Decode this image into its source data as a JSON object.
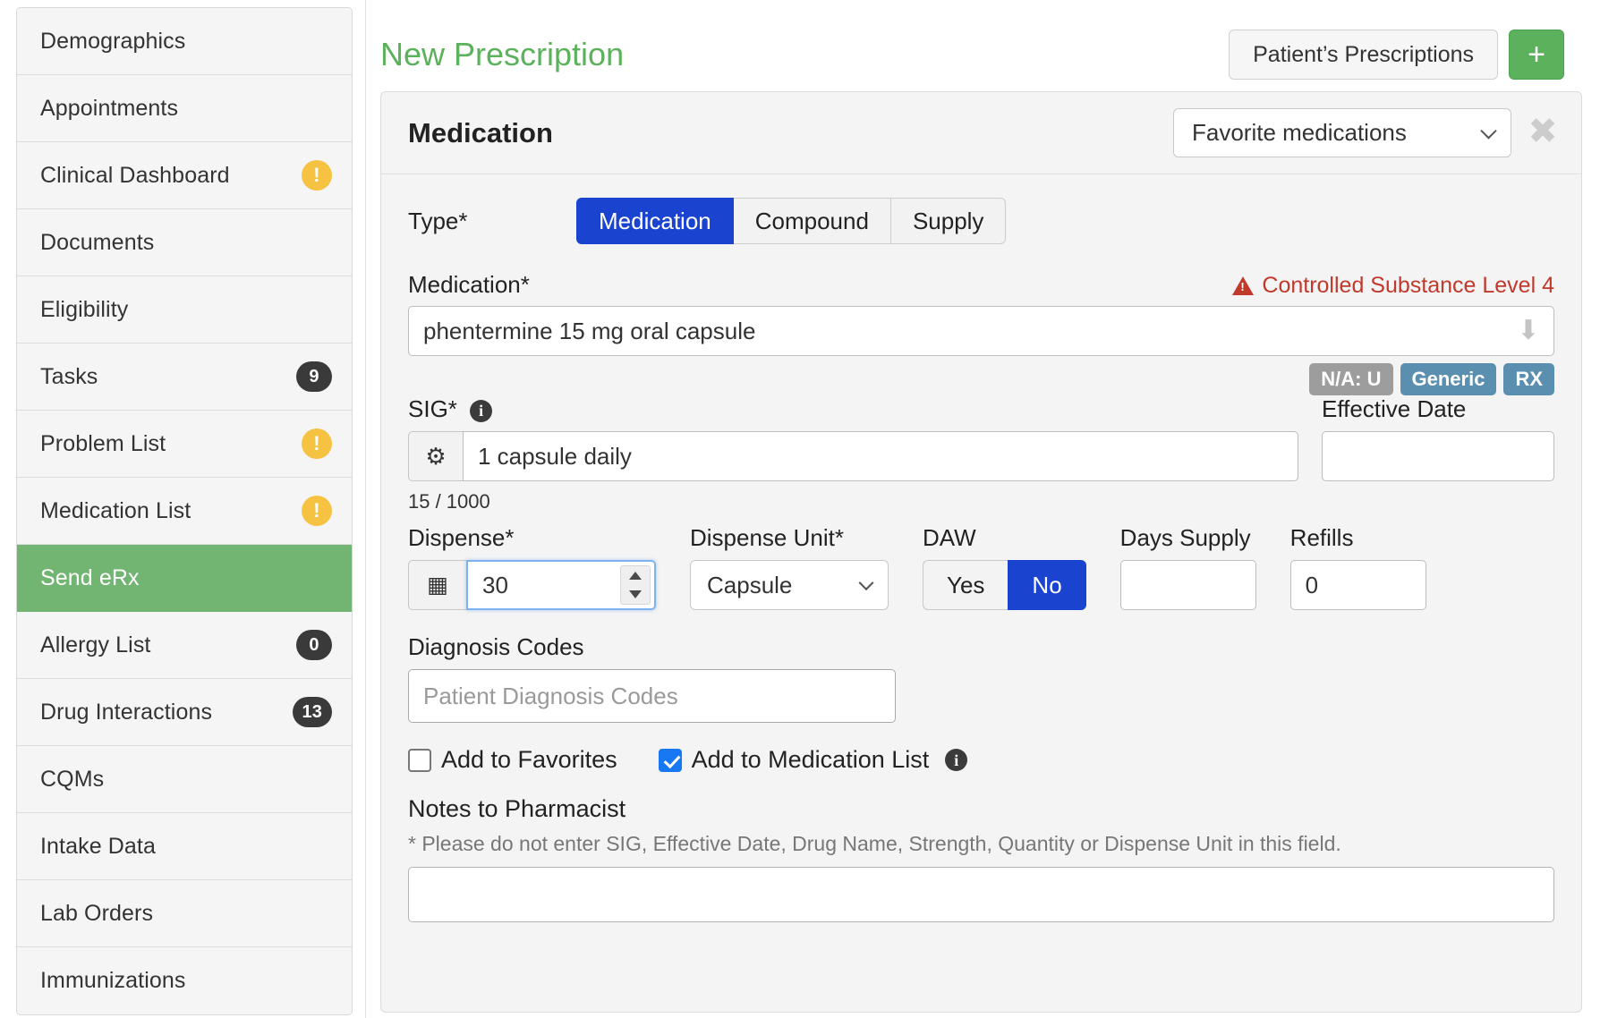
{
  "sidebar": {
    "items": [
      {
        "label": "Demographics",
        "badge": null,
        "badge_type": null,
        "active": false
      },
      {
        "label": "Appointments",
        "badge": null,
        "badge_type": null,
        "active": false
      },
      {
        "label": "Clinical Dashboard",
        "badge": "!",
        "badge_type": "warn",
        "active": false
      },
      {
        "label": "Documents",
        "badge": null,
        "badge_type": null,
        "active": false
      },
      {
        "label": "Eligibility",
        "badge": null,
        "badge_type": null,
        "active": false
      },
      {
        "label": "Tasks",
        "badge": "9",
        "badge_type": "count",
        "active": false
      },
      {
        "label": "Problem List",
        "badge": "!",
        "badge_type": "warn",
        "active": false
      },
      {
        "label": "Medication List",
        "badge": "!",
        "badge_type": "warn",
        "active": false
      },
      {
        "label": "Send eRx",
        "badge": null,
        "badge_type": null,
        "active": true
      },
      {
        "label": "Allergy List",
        "badge": "0",
        "badge_type": "count",
        "active": false
      },
      {
        "label": "Drug Interactions",
        "badge": "13",
        "badge_type": "count",
        "active": false
      },
      {
        "label": "CQMs",
        "badge": null,
        "badge_type": null,
        "active": false
      },
      {
        "label": "Intake Data",
        "badge": null,
        "badge_type": null,
        "active": false
      },
      {
        "label": "Lab Orders",
        "badge": null,
        "badge_type": null,
        "active": false
      },
      {
        "label": "Immunizations",
        "badge": null,
        "badge_type": null,
        "active": false
      }
    ]
  },
  "header": {
    "title": "New Prescription",
    "patient_prescriptions_label": "Patient’s Prescriptions",
    "add_label": "+"
  },
  "panel": {
    "title": "Medication",
    "favorites_select_value": "Favorite medications",
    "close_label": "✖"
  },
  "form": {
    "type_label": "Type*",
    "type_options": [
      "Medication",
      "Compound",
      "Supply"
    ],
    "type_selected": "Medication",
    "medication_label": "Medication*",
    "medication_warning": "Controlled Substance Level 4",
    "medication_value": "phentermine 15 mg oral capsule",
    "medication_tags": [
      {
        "text": "N/A: U",
        "color": "grey"
      },
      {
        "text": "Generic",
        "color": "blue"
      },
      {
        "text": "RX",
        "color": "blue"
      }
    ],
    "sig_label": "SIG*",
    "sig_value": "1 capsule daily",
    "sig_char_count": "15 / 1000",
    "sig_gear_icon": "gear-icon",
    "effective_date_label": "Effective Date",
    "effective_date_value": "",
    "dispense_label": "Dispense*",
    "dispense_value": "30",
    "dispense_calc_icon": "calculator-icon",
    "dispense_unit_label": "Dispense Unit*",
    "dispense_unit_value": "Capsule",
    "daw_label": "DAW",
    "daw_options": [
      "Yes",
      "No"
    ],
    "daw_selected": "No",
    "days_supply_label": "Days Supply",
    "days_supply_value": "",
    "refills_label": "Refills",
    "refills_value": "0",
    "diagnosis_label": "Diagnosis Codes",
    "diagnosis_placeholder": "Patient Diagnosis Codes",
    "diagnosis_value": "",
    "add_favorites_label": "Add to Favorites",
    "add_favorites_checked": false,
    "add_medication_list_label": "Add to Medication List",
    "add_medication_list_checked": true,
    "notes_title": "Notes to Pharmacist",
    "notes_hint": "* Please do not enter SIG, Effective Date, Drug Name, Strength, Quantity or Dispense Unit in this field.",
    "notes_value": ""
  },
  "colors": {
    "accent_green": "#5cb25c",
    "active_blue": "#1a44d0",
    "warning_red": "#c0392b",
    "badge_yellow": "#f5c242",
    "tag_blue": "#5a8fb0",
    "tag_grey": "#9d9d9d"
  }
}
